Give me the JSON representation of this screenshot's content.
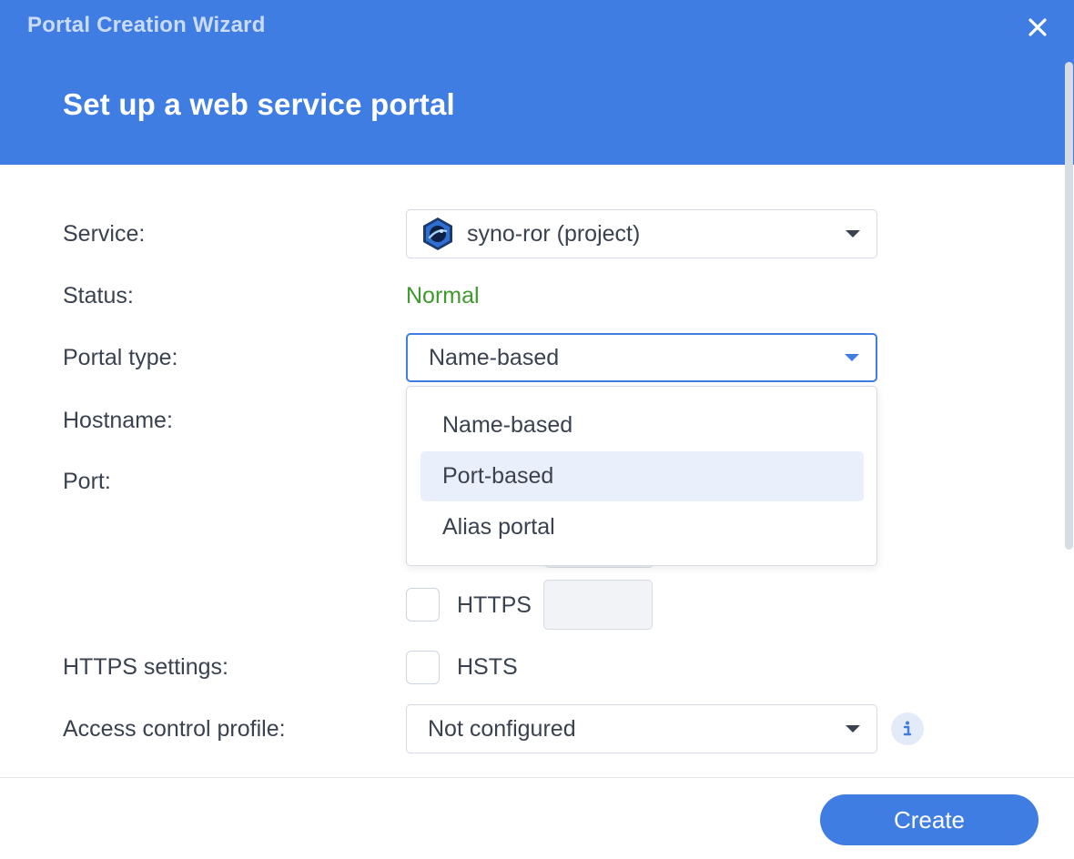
{
  "window": {
    "title": "Portal Creation Wizard"
  },
  "page": {
    "heading": "Set up a web service portal"
  },
  "form": {
    "service": {
      "label": "Service:",
      "value": "syno-ror (project)"
    },
    "status": {
      "label": "Status:",
      "value": "Normal",
      "color": "#3e9a2c"
    },
    "portal_type": {
      "label": "Portal type:",
      "value": "Name-based",
      "options": [
        "Name-based",
        "Port-based",
        "Alias portal"
      ],
      "hovered_option": "Port-based"
    },
    "hostname": {
      "label": "Hostname:"
    },
    "port": {
      "label": "Port:",
      "https_label": "HTTPS",
      "https_checked": false
    },
    "https_settings": {
      "label": "HTTPS settings:",
      "hsts_label": "HSTS",
      "hsts_checked": false
    },
    "access_control": {
      "label": "Access control profile:",
      "value": "Not configured"
    }
  },
  "footer": {
    "create_label": "Create"
  },
  "colors": {
    "accent": "#3f7de3",
    "status_ok": "#3e9a2c",
    "hover": "#eaf0fb"
  },
  "icons": {
    "close": "close-icon",
    "service": "service-app-icon",
    "info": "info-icon"
  }
}
